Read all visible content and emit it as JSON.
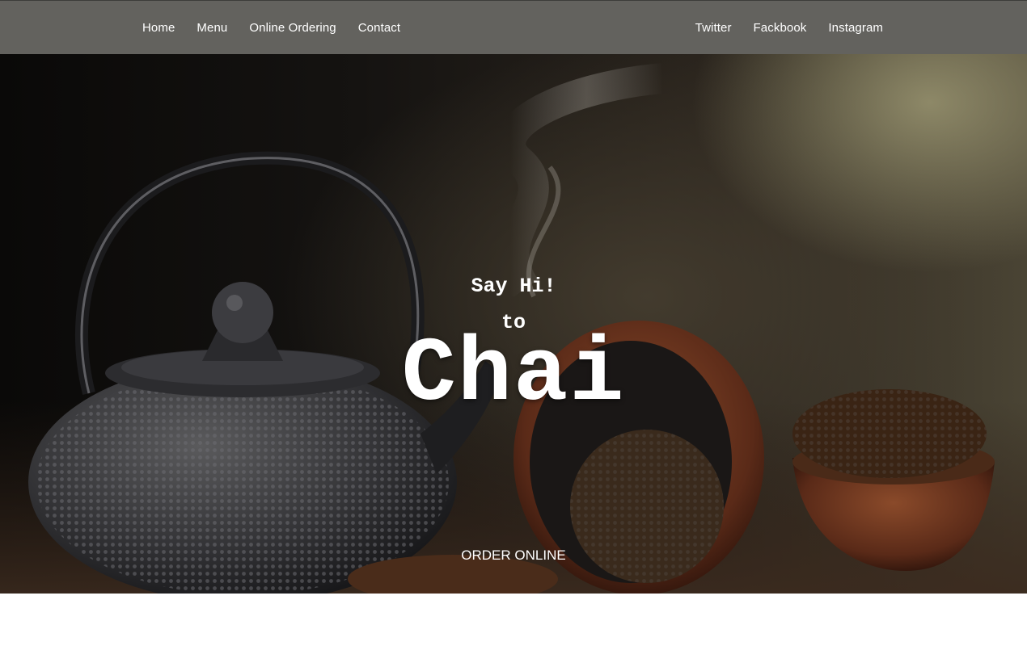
{
  "nav": {
    "left": [
      {
        "label": "Home"
      },
      {
        "label": "Menu"
      },
      {
        "label": "Online Ordering"
      },
      {
        "label": "Contact"
      }
    ],
    "right": [
      {
        "label": "Twitter"
      },
      {
        "label": "Fackbook"
      },
      {
        "label": "Instagram"
      }
    ]
  },
  "hero": {
    "greeting": "Say Hi!",
    "connector": "to",
    "brand": "Chai",
    "cta": "ORDER ONLINE",
    "image": "teapot-and-tea-leaves-photo"
  },
  "colors": {
    "navbar": "#63625e",
    "text": "#ffffff",
    "page_background": "#ffffff"
  }
}
